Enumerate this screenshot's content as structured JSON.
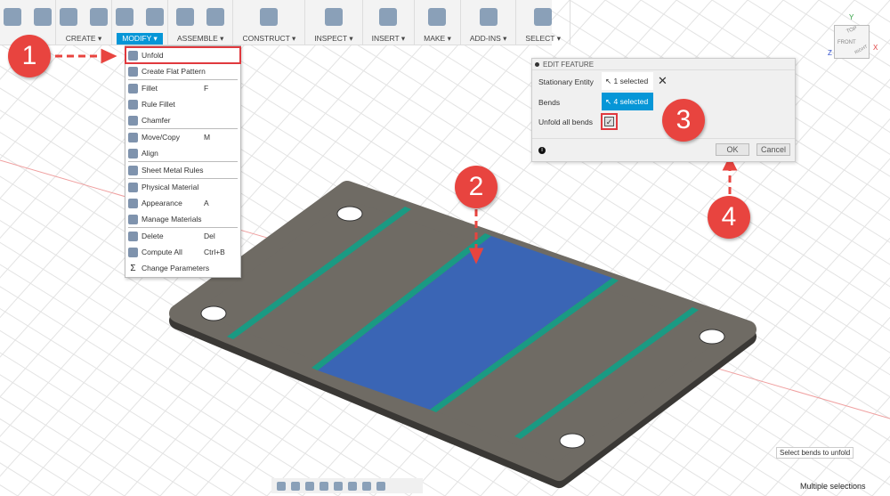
{
  "toolbar": {
    "groups": [
      {
        "label": "",
        "icons": [
          "sketch-icon",
          "dimension-icon"
        ]
      },
      {
        "label": "CREATE ▾",
        "icons": [
          "create-box-icon",
          "extrude-flange-icon"
        ]
      },
      {
        "label": "MODIFY ▾",
        "icons": [
          "sheet-metal-rules-icon",
          "flat-pattern-icon"
        ],
        "active": true
      },
      {
        "label": "ASSEMBLE ▾",
        "icons": [
          "new-component-icon",
          "joint-icon"
        ]
      },
      {
        "label": "CONSTRUCT ▾",
        "icons": [
          "plane-icon"
        ]
      },
      {
        "label": "INSPECT ▾",
        "icons": [
          "measure-icon"
        ]
      },
      {
        "label": "INSERT ▾",
        "icons": [
          "image-icon"
        ]
      },
      {
        "label": "MAKE ▾",
        "icons": [
          "3d-print-icon"
        ]
      },
      {
        "label": "ADD-INS ▾",
        "icons": [
          "scripts-icon"
        ]
      },
      {
        "label": "SELECT ▾",
        "icons": [
          "select-icon"
        ]
      }
    ]
  },
  "menu": {
    "items": [
      {
        "label": "Unfold",
        "shortcut": "",
        "highlight": true
      },
      {
        "label": "Create Flat Pattern",
        "shortcut": ""
      },
      {
        "sep": true
      },
      {
        "label": "Fillet",
        "shortcut": "F"
      },
      {
        "label": "Rule Fillet",
        "shortcut": ""
      },
      {
        "label": "Chamfer",
        "shortcut": ""
      },
      {
        "sep": true
      },
      {
        "label": "Move/Copy",
        "shortcut": "M"
      },
      {
        "label": "Align",
        "shortcut": ""
      },
      {
        "sep": true
      },
      {
        "label": "Sheet Metal Rules",
        "shortcut": ""
      },
      {
        "sep": true
      },
      {
        "label": "Physical Material",
        "shortcut": ""
      },
      {
        "label": "Appearance",
        "shortcut": "A"
      },
      {
        "label": "Manage Materials",
        "shortcut": ""
      },
      {
        "sep": true
      },
      {
        "label": "Delete",
        "shortcut": "Del"
      },
      {
        "label": "Compute All",
        "shortcut": "Ctrl+B"
      },
      {
        "label": "Change Parameters",
        "shortcut": "",
        "icon": "Σ"
      }
    ]
  },
  "dialog": {
    "title": "EDIT FEATURE",
    "stationary_label": "Stationary Entity",
    "stationary_value": "1 selected",
    "bends_label": "Bends",
    "bends_value": "4 selected",
    "unfold_label": "Unfold all bends",
    "unfold_checked": true,
    "ok": "OK",
    "cancel": "Cancel"
  },
  "annotations": [
    "1",
    "2",
    "3",
    "4"
  ],
  "viewcube": {
    "front": "FRONT",
    "right": "RIGHT",
    "top": "TOP",
    "x": "X",
    "y": "Y",
    "z": "Z"
  },
  "status": {
    "tooltip": "Select bends to unfold",
    "selection": "Multiple selections"
  },
  "colors": {
    "accent": "#0696d7",
    "annotation": "#e8443f",
    "plate": "#6f6b64",
    "bend": "#1a9a83",
    "selected_face": "#3a65b5"
  }
}
